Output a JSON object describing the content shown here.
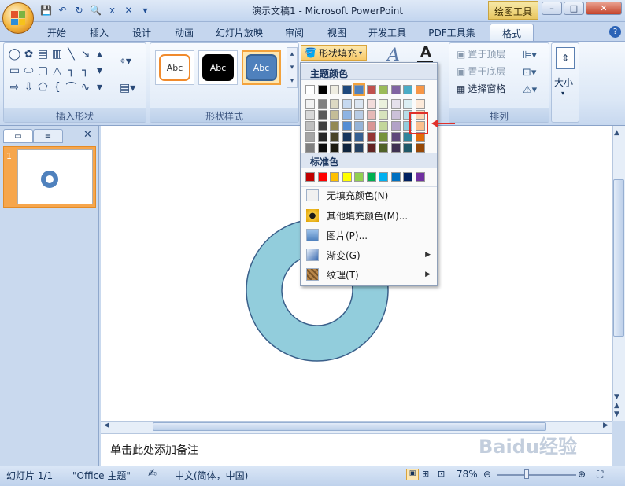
{
  "window": {
    "title": "演示文稿1 - Microsoft PowerPoint",
    "context_tab": "绘图工具",
    "min": "–",
    "max": "□",
    "close": "✕"
  },
  "qat": {
    "save": "💾",
    "undo": "↶",
    "redo": "↻",
    "preview": "🔍",
    "format": "x",
    "close": "✕",
    "more": "▾"
  },
  "tabs": [
    "开始",
    "插入",
    "设计",
    "动画",
    "幻灯片放映",
    "审阅",
    "视图",
    "开发工具",
    "PDF工具集",
    "格式"
  ],
  "help": "?",
  "ribbon": {
    "groups": {
      "insert_shapes": "插入形状",
      "shape_styles": "形状样式",
      "arrange": "排列"
    },
    "style_samples": [
      "Abc",
      "Abc",
      "Abc"
    ],
    "shape_fill": "形状填充",
    "bring_front": "置于顶层",
    "send_back": "置于底层",
    "selection_pane": "选择窗格",
    "size": "大小"
  },
  "fill_menu": {
    "theme_colors_header": "主题颜色",
    "standard_colors_header": "标准色",
    "theme_top_row": [
      "#ffffff",
      "#000000",
      "#eeece1",
      "#1f497d",
      "#4f81bd",
      "#c0504d",
      "#9bbb59",
      "#8064a2",
      "#4bacc6",
      "#f79646"
    ],
    "theme_shades": [
      [
        "#f2f2f2",
        "#7f7f7f",
        "#ddd9c3",
        "#c6d9f0",
        "#dbe5f1",
        "#f2dcdb",
        "#ebf1dd",
        "#e5e0ec",
        "#dbeef3",
        "#fdeada"
      ],
      [
        "#d8d8d8",
        "#595959",
        "#c4bd97",
        "#8db3e2",
        "#b8cce4",
        "#e5b9b7",
        "#d7e3bc",
        "#ccc1d9",
        "#b7dde8",
        "#fbd5b5"
      ],
      [
        "#bfbfbf",
        "#3f3f3f",
        "#938953",
        "#548dd4",
        "#95b3d7",
        "#d99694",
        "#c3d69b",
        "#b2a2c7",
        "#92cddc",
        "#fac08f"
      ],
      [
        "#a5a5a5",
        "#262626",
        "#494429",
        "#17365d",
        "#366092",
        "#953734",
        "#76923c",
        "#5f497a",
        "#31859b",
        "#e36c09"
      ],
      [
        "#7f7f7f",
        "#0c0c0c",
        "#1d1b10",
        "#0f243e",
        "#244061",
        "#632423",
        "#4f6128",
        "#3f3151",
        "#205867",
        "#974806"
      ]
    ],
    "standard": [
      "#c00000",
      "#ff0000",
      "#ffc000",
      "#ffff00",
      "#92d050",
      "#00b050",
      "#00b0f0",
      "#0070c0",
      "#002060",
      "#7030a0"
    ],
    "items": [
      "无填充颜色(N)",
      "其他填充颜色(M)...",
      "图片(P)...",
      "渐变(G)",
      "纹理(T)"
    ]
  },
  "panel": {
    "slide_number": "1",
    "close": "✕"
  },
  "notes": "单击此处添加备注",
  "status": {
    "slide": "幻灯片 1/1",
    "theme": "\"Office 主题\"",
    "language": "中文(简体，中国)",
    "zoom": "78%"
  },
  "colors": {
    "donut_fill": "#92cddc",
    "donut_stroke": "#3a5f8a",
    "accent": "#f6a64c"
  },
  "watermark": "Baidu经验"
}
